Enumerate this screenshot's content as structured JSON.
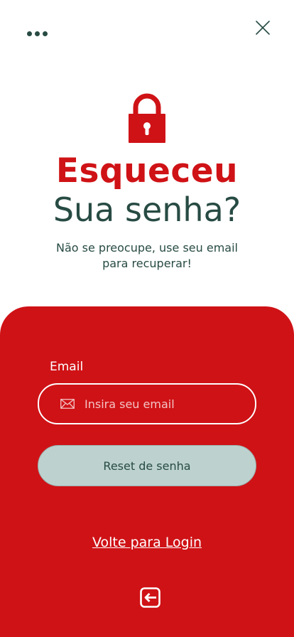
{
  "header": {
    "menu_icon": "more-horizontal-icon",
    "close_icon": "close-icon"
  },
  "hero": {
    "lock_icon": "padlock-icon",
    "title_line1": "Esqueceu",
    "title_line2": "Sua senha?",
    "subtitle": "Não se preocupe, use seu email para recuperar!"
  },
  "form": {
    "email_label": "Email",
    "email_placeholder": "Insira seu email",
    "email_value": "",
    "email_icon": "mail-icon",
    "reset_button": "Reset de senha",
    "back_link": "Volte para Login",
    "back_icon": "exit-arrow-icon"
  },
  "colors": {
    "primary_red": "#cf1216",
    "dark_green": "#274b43",
    "button_bg": "#bdd2cf",
    "white": "#ffffff"
  }
}
